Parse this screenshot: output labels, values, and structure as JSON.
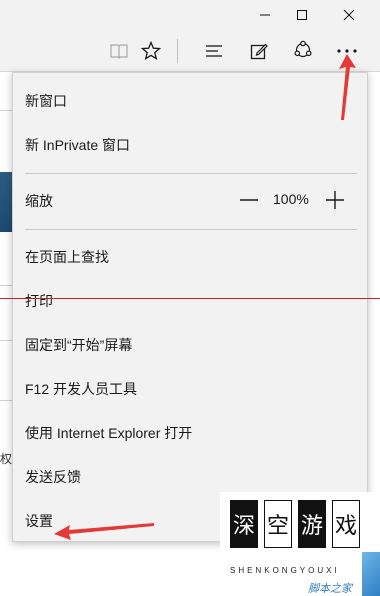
{
  "window_controls": {
    "minimize": "minimize-icon",
    "maximize": "maximize-icon",
    "close": "close-icon"
  },
  "toolbar": {
    "icons": [
      "reading-view-icon",
      "favorites-star-icon",
      "hub-icon",
      "web-note-icon",
      "share-icon",
      "more-actions-icon"
    ]
  },
  "page": {
    "left_char": "权"
  },
  "menu": {
    "items": [
      {
        "label": "新窗口"
      },
      {
        "label": "新 InPrivate 窗口"
      },
      {
        "label": "缩放"
      },
      {
        "label": "在页面上查找"
      },
      {
        "label": "打印"
      },
      {
        "label": "固定到“开始”屏幕"
      },
      {
        "label": "F12 开发人员工具"
      },
      {
        "label": "使用 Internet Explorer 打开"
      },
      {
        "label": "发送反馈"
      },
      {
        "label": "设置"
      }
    ],
    "zoom": {
      "value": "100%"
    }
  },
  "annotations": {
    "color": "#e53935"
  },
  "watermark": {
    "chars": [
      "深",
      "空",
      "游",
      "戏"
    ],
    "subtitle": "SHENKONGYOUXI",
    "corner_text": "脚本之家"
  }
}
